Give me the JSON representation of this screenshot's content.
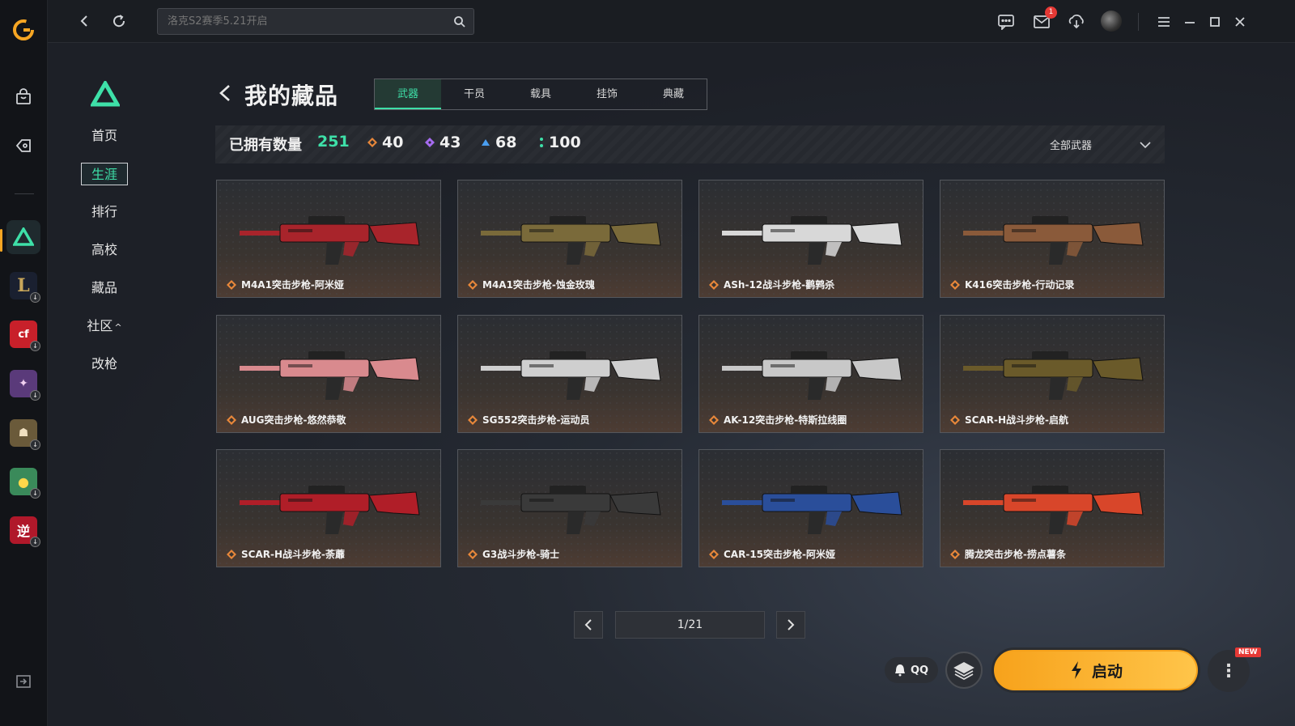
{
  "topbar": {
    "search_placeholder": "洛克S2赛季5.21开启",
    "mail_badge": "1"
  },
  "subnav": {
    "items": [
      {
        "label": "首页"
      },
      {
        "label": "生涯"
      },
      {
        "label": "排行"
      },
      {
        "label": "高校"
      },
      {
        "label": "藏品"
      },
      {
        "label": "社区"
      },
      {
        "label": "改枪"
      }
    ],
    "community_caret": "^"
  },
  "header": {
    "title": "我的藏品",
    "tabs": [
      {
        "label": "武器"
      },
      {
        "label": "干员"
      },
      {
        "label": "载具"
      },
      {
        "label": "挂饰"
      },
      {
        "label": "典藏"
      }
    ]
  },
  "stats": {
    "owned_label": "已拥有数量",
    "owned_count": "251",
    "rarities": [
      {
        "count": "40",
        "color": "#e8873a"
      },
      {
        "count": "43",
        "color": "#a56bf0"
      },
      {
        "count": "68",
        "color": "#4a9ef0"
      },
      {
        "count": "100",
        "color": "#3ee0a8"
      }
    ],
    "filter_label": "全部武器"
  },
  "items": [
    {
      "name": "M4A1突击步枪-阿米娅",
      "color": "#a8242b"
    },
    {
      "name": "M4A1突击步枪-蚀金玫瑰",
      "color": "#7a6a3a"
    },
    {
      "name": "ASh-12战斗步枪-鹳鹑杀",
      "color": "#d8d8d8"
    },
    {
      "name": "K416突击步枪-行动记录",
      "color": "#8a5a3a"
    },
    {
      "name": "AUG突击步枪-悠然恭敬",
      "color": "#d98a8e"
    },
    {
      "name": "SG552突击步枪-运动员",
      "color": "#cfcfcf"
    },
    {
      "name": "AK-12突击步枪-特斯拉线圈",
      "color": "#c8c8c8"
    },
    {
      "name": "SCAR-H战斗步枪-启航",
      "color": "#6a5a2a"
    },
    {
      "name": "SCAR-H战斗步枪-荼蘼",
      "color": "#b01e28"
    },
    {
      "name": "G3战斗步枪-骑士",
      "color": "#3a3a3a"
    },
    {
      "name": "CAR-15突击步枪-阿米娅",
      "color": "#2a4e9a"
    },
    {
      "name": "腾龙突击步枪-捞点薯条",
      "color": "#d8462a"
    }
  ],
  "pagination": {
    "text": "1/21"
  },
  "bottom": {
    "qq_label": "QQ",
    "launch_label": "启动",
    "new_tag": "NEW",
    "more_label": "⋮"
  },
  "colors": {
    "accent_green": "#3ee0a8",
    "launch_orange": "#f7a21b"
  }
}
